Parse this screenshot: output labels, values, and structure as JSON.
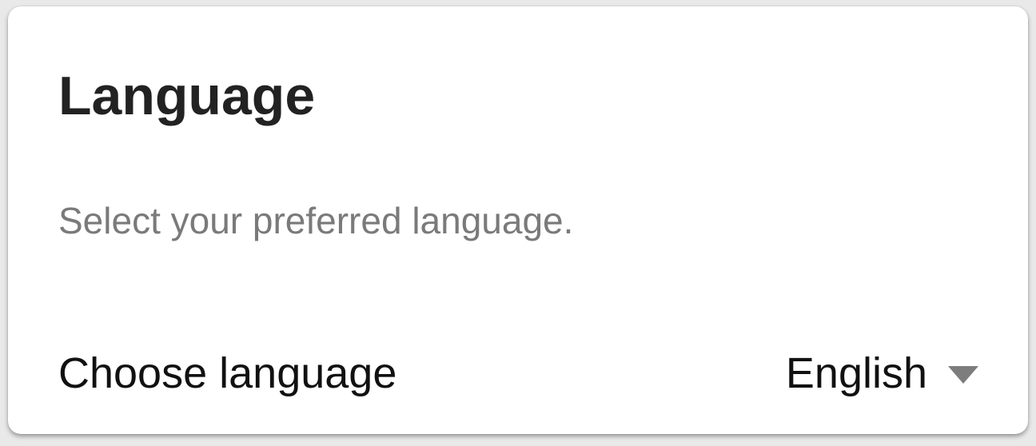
{
  "section": {
    "title": "Language",
    "description": "Select your preferred language."
  },
  "language_setting": {
    "label": "Choose language",
    "selected_value": "English",
    "dropdown_icon": "triangle-down-icon"
  }
}
